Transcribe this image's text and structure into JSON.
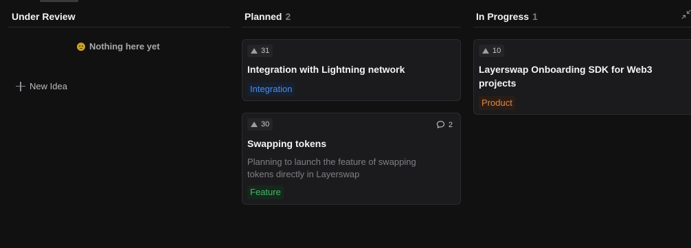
{
  "columns": {
    "under_review": {
      "title": "Under Review",
      "empty_text": "Nothing here yet",
      "new_idea_label": "New Idea"
    },
    "planned": {
      "title": "Planned",
      "count": "2",
      "cards": [
        {
          "votes": "31",
          "title": "Integration with Lightning network",
          "tag": "Integration"
        },
        {
          "votes": "30",
          "title": "Swapping tokens",
          "description": "Planning to launch the feature of swapping tokens directly in Layerswap",
          "tag": "Feature",
          "comments": "2"
        }
      ]
    },
    "in_progress": {
      "title": "In Progress",
      "count": "1",
      "cards": [
        {
          "votes": "10",
          "title": "Layerswap Onboarding SDK for Web3 projects",
          "tag": "Product"
        }
      ]
    }
  },
  "colors": {
    "background": "#111112",
    "card_background": "#1b1b1d",
    "tag_integration": "#4f8fe0",
    "tag_feature": "#44b86a",
    "tag_product": "#d88a4e"
  },
  "icons": {
    "upvote": "triangle-up-icon",
    "comment": "comment-bubble-icon",
    "add": "plus-icon",
    "expand": "collapse-arrows-icon",
    "empty": "neutral-face-emoji"
  }
}
